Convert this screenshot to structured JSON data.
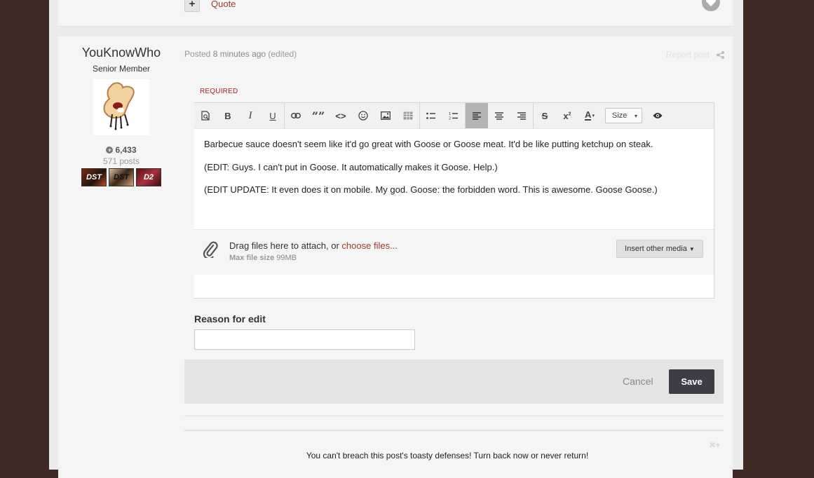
{
  "prev_post": {
    "plus_label": "+",
    "quote_label": "Quote"
  },
  "author": {
    "name": "YouKnowWho",
    "rank": "Senior Member",
    "reputation": "6,433",
    "posts": "571 posts",
    "badges": [
      "DST",
      "DST",
      "D2"
    ]
  },
  "post_meta": {
    "posted_prefix": "Posted ",
    "posted_ago": "8 minutes ago",
    "edited": " (edited)",
    "report_label": "Report post"
  },
  "editor": {
    "required_label": "REQUIRED",
    "size_label": "Size",
    "content": [
      "Barbecue sauce doesn't seem like it'd go great with Goose or Goose meat. It'd be like putting ketchup on steak.",
      "(EDIT: Guys. I can't put in Goose. It automatically makes it Goose. Help.)",
      "(EDIT UPDATE: It even does it on mobile. My god. Goose: the forbidden word. This is awesome. Goose Goose.)"
    ],
    "attach_prefix": "Drag files here to attach, or ",
    "attach_link": "choose files...",
    "max_size_label": "Max file size",
    "max_size_value": "99MB",
    "insert_media_label": "Insert other media"
  },
  "reason": {
    "label": "Reason for edit",
    "value": ""
  },
  "actions": {
    "cancel_label": "Cancel",
    "save_label": "Save"
  },
  "signature": "You can't breach this post's toasty defenses! Turn back now or never return!",
  "colors": {
    "background": "#3e2a22",
    "accent_link": "#9b3b2a",
    "save_button": "#3d3e45"
  }
}
